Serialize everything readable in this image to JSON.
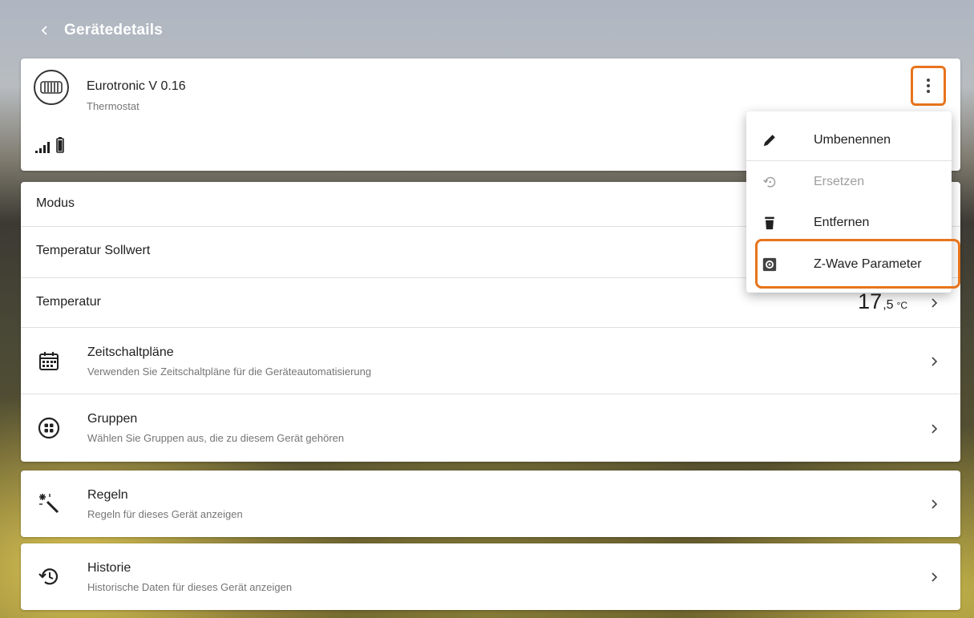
{
  "header": {
    "title": "Gerätedetails"
  },
  "device": {
    "name": "Eurotronic V 0.16",
    "type": "Thermostat"
  },
  "rows": {
    "modus": {
      "label": "Modus"
    },
    "sollwert": {
      "label": "Temperatur Sollwert"
    },
    "temperatur": {
      "label": "Temperatur",
      "value_int": "17",
      "value_dec": ",5",
      "unit": "°C"
    },
    "zeitschaltplaene": {
      "title": "Zeitschaltpläne",
      "subtitle": "Verwenden Sie Zeitschaltpläne für die Geräteautomatisierung"
    },
    "gruppen": {
      "title": "Gruppen",
      "subtitle": "Wählen Sie Gruppen aus, die zu diesem Gerät gehören"
    }
  },
  "regeln": {
    "title": "Regeln",
    "subtitle": "Regeln für dieses Gerät anzeigen"
  },
  "historie": {
    "title": "Historie",
    "subtitle": "Historische Daten für dieses Gerät anzeigen"
  },
  "menu": {
    "items": [
      {
        "label": "Umbenennen",
        "icon": "pencil-icon",
        "disabled": false
      },
      {
        "label": "Ersetzen",
        "icon": "replace-icon",
        "disabled": true
      },
      {
        "label": "Entfernen",
        "icon": "trash-icon",
        "disabled": false
      },
      {
        "label": "Z-Wave Parameter",
        "icon": "gear-icon",
        "disabled": false
      }
    ]
  },
  "colors": {
    "highlight": "#e8741c",
    "header_text": "#ffffff"
  }
}
